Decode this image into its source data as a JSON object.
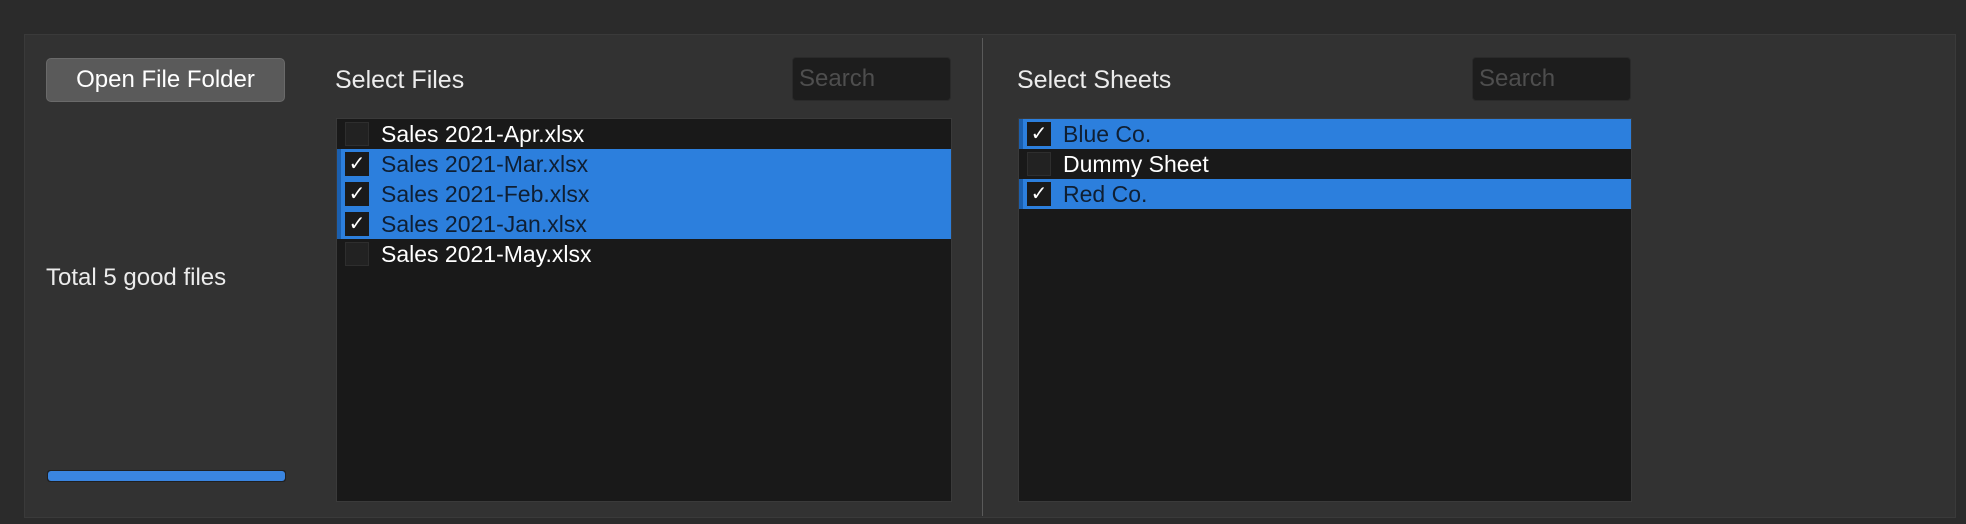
{
  "left_panel": {
    "open_button_label": "Open File Folder",
    "total_label": "Total 5 good files",
    "progress": 1.0
  },
  "files": {
    "title": "Select Files",
    "search_placeholder": "Search",
    "items": [
      {
        "label": "Sales 2021-Apr.xlsx",
        "checked": false,
        "check": ""
      },
      {
        "label": "Sales 2021-Mar.xlsx",
        "checked": true,
        "check": "✓"
      },
      {
        "label": "Sales 2021-Feb.xlsx",
        "checked": true,
        "check": "✓"
      },
      {
        "label": "Sales 2021-Jan.xlsx",
        "checked": true,
        "check": "✓"
      },
      {
        "label": "Sales 2021-May.xlsx",
        "checked": false,
        "check": ""
      }
    ]
  },
  "sheets": {
    "title": "Select Sheets",
    "search_placeholder": "Search",
    "items": [
      {
        "label": "Blue Co.",
        "checked": true,
        "check": "✓"
      },
      {
        "label": "Dummy Sheet",
        "checked": false,
        "check": ""
      },
      {
        "label": "Red Co.",
        "checked": true,
        "check": "✓"
      }
    ]
  },
  "colors": {
    "selection": "#2c7fdd",
    "progress": "#3a85e0"
  }
}
